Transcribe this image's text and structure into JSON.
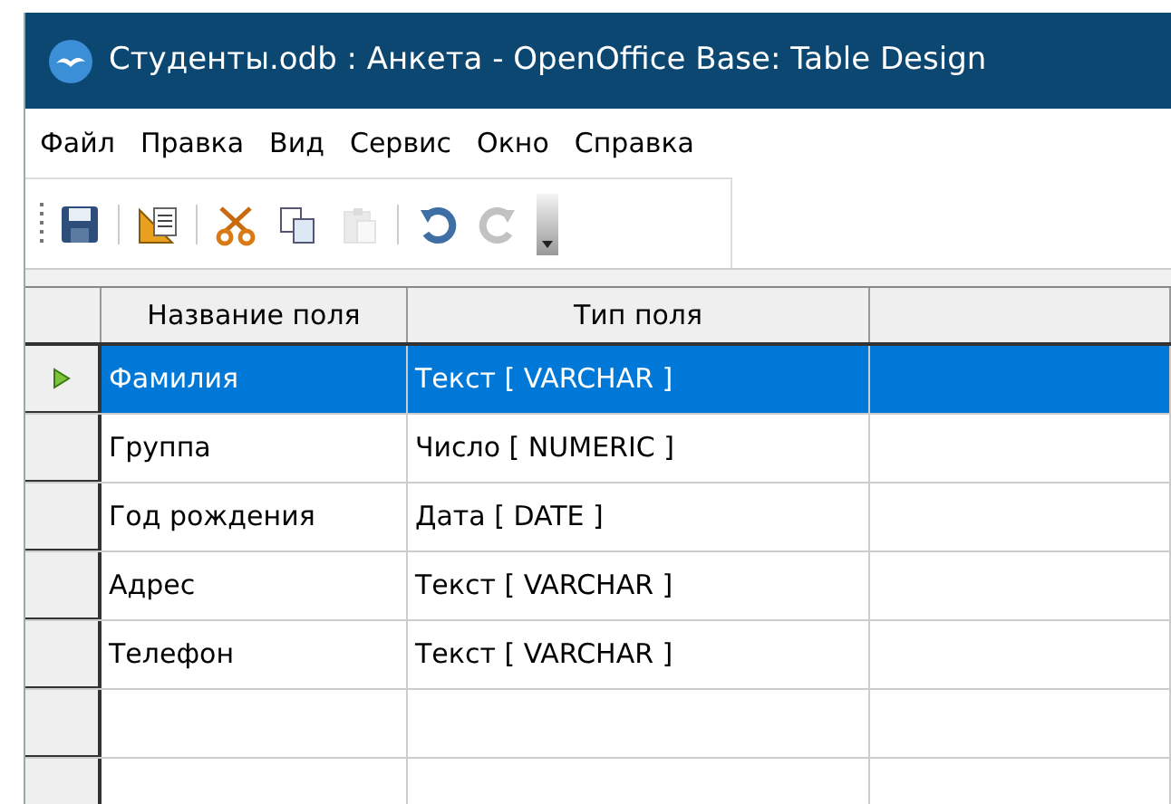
{
  "window": {
    "title": "Студенты.odb : Анкета - OpenOffice Base: Table Design"
  },
  "menu": [
    "Файл",
    "Правка",
    "Вид",
    "Сервис",
    "Окно",
    "Справка"
  ],
  "toolbar": [
    {
      "kind": "save",
      "disabled": false
    },
    {
      "kind": "separator"
    },
    {
      "kind": "design",
      "disabled": false
    },
    {
      "kind": "separator"
    },
    {
      "kind": "cut",
      "disabled": false
    },
    {
      "kind": "copy",
      "disabled": false
    },
    {
      "kind": "paste",
      "disabled": true
    },
    {
      "kind": "separator"
    },
    {
      "kind": "undo",
      "disabled": false
    },
    {
      "kind": "redo",
      "disabled": true
    },
    {
      "kind": "more"
    }
  ],
  "table": {
    "columns": [
      "Название поля",
      "Тип поля"
    ],
    "rows": [
      {
        "name": "Фамилия",
        "type": "Текст [ VARCHAR ]",
        "selected": true
      },
      {
        "name": "Группа",
        "type": "Число [ NUMERIC ]",
        "selected": false
      },
      {
        "name": "Год рождения",
        "type": "Дата [ DATE ]",
        "selected": false
      },
      {
        "name": "Адрес",
        "type": "Текст [ VARCHAR ]",
        "selected": false
      },
      {
        "name": "Телефон",
        "type": "Текст [ VARCHAR ]",
        "selected": false
      }
    ]
  }
}
